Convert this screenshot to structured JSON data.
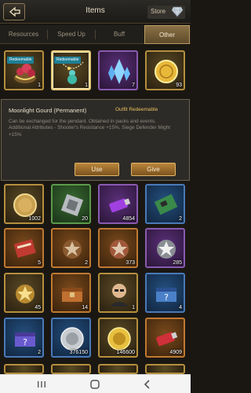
{
  "header": {
    "title": "Items",
    "store_label": "Store"
  },
  "tabs": [
    {
      "label": "Resources"
    },
    {
      "label": "Speed Up"
    },
    {
      "label": "Buff"
    },
    {
      "label": "Other",
      "active": true
    }
  ],
  "grid": {
    "rows": [
      [
        {
          "icon": "rose-bouquet-icon",
          "badge": "Redeemable",
          "count": "1",
          "quality": "gold"
        },
        {
          "icon": "moonlight-gourd-pendant-icon",
          "badge": "Redeemable",
          "count": "1",
          "quality": "gold",
          "selected": true
        },
        {
          "icon": "blue-crystal-icon",
          "badge": "",
          "count": "7",
          "quality": "purple"
        },
        {
          "icon": "gold-coin-icon",
          "badge": "",
          "count": "93",
          "quality": "gold"
        }
      ],
      [
        {
          "icon": "gold-medal-icon",
          "count": "1002",
          "quality": "gold"
        },
        {
          "icon": "silver-chip-icon",
          "count": "20",
          "quality": "green"
        },
        {
          "icon": "purple-usb-icon",
          "count": "4854",
          "quality": "purple"
        },
        {
          "icon": "circuit-board-icon",
          "count": "2",
          "quality": "blue"
        }
      ],
      [
        {
          "icon": "red-book-icon",
          "count": "5",
          "quality": "orange"
        },
        {
          "icon": "bronze-star-badge-icon",
          "count": "2",
          "quality": "orange"
        },
        {
          "icon": "copper-star-badge-icon",
          "count": "373",
          "quality": "orange"
        },
        {
          "icon": "silver-star-badge-icon",
          "count": "285",
          "quality": "purple"
        }
      ],
      [
        {
          "icon": "gold-star-badge-icon",
          "count": "45",
          "quality": "gold"
        },
        {
          "icon": "orange-crate-icon",
          "count": "14",
          "quality": "orange"
        },
        {
          "icon": "commander-portrait-icon",
          "count": "1",
          "quality": "gold"
        },
        {
          "icon": "mystery-box-icon",
          "count": "4",
          "quality": "blue"
        }
      ],
      [
        {
          "icon": "purple-mystery-box-icon",
          "count": "2",
          "quality": "blue"
        },
        {
          "icon": "silver-token-icon",
          "count": "376150",
          "quality": "blue"
        },
        {
          "icon": "gold-token-icon",
          "count": "146600",
          "quality": "gold"
        },
        {
          "icon": "red-usb-icon",
          "count": "4909",
          "quality": "orange"
        }
      ]
    ]
  },
  "detail": {
    "name": "Moonlight Gourd (Permanent)",
    "status": "Outfit Redeemable",
    "description": "Can be exchanged for the pendant. Obtained in packs and events.",
    "attributes": "Additional Attributes - Shooter's Resistance +15%, Siege Defender Might +15%",
    "use_label": "Use",
    "give_label": "Give"
  },
  "navbar": {
    "icons": [
      "recent-apps-icon",
      "home-icon",
      "back-icon"
    ]
  }
}
